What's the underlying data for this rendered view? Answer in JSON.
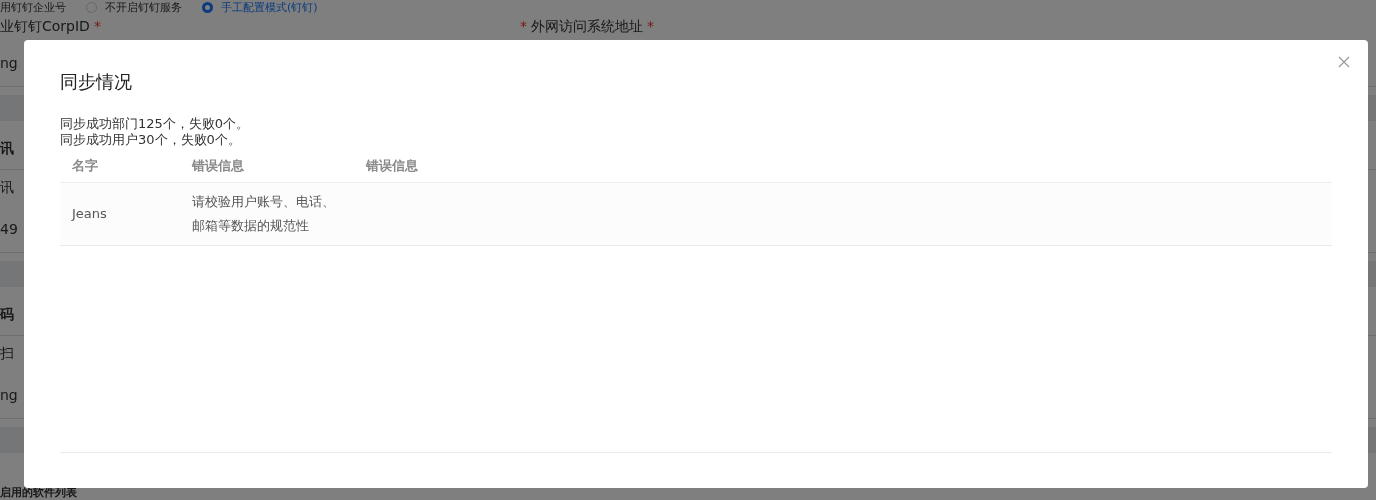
{
  "background": {
    "rows": [
      {
        "kind": "radios",
        "label": "用钉钉企业号",
        "options": [
          {
            "label": "不开启钉钉服务",
            "selected": false
          },
          {
            "label": "手工配置模式(钉钉)",
            "selected": true
          }
        ]
      },
      {
        "kind": "labels",
        "fields": [
          {
            "label": "业钉钉CorpID",
            "suffix": "*"
          },
          {
            "prefix": "*",
            "label": "外网访问系统地址",
            "suffix": "*"
          }
        ]
      },
      {
        "kind": "input",
        "value": "ng"
      },
      {
        "kind": "band"
      },
      {
        "kind": "section",
        "text": "讯"
      },
      {
        "kind": "text",
        "text": "讯"
      },
      {
        "kind": "input",
        "value": "49"
      },
      {
        "kind": "band"
      },
      {
        "kind": "section",
        "text": "码"
      },
      {
        "kind": "text",
        "text": "扫"
      },
      {
        "kind": "input",
        "value": "ng"
      },
      {
        "kind": "band"
      },
      {
        "kind": "section",
        "text": "启用的软件列表"
      }
    ]
  },
  "dialog": {
    "title": "同步情况",
    "summary": [
      "同步成功部门125个，失败0个。",
      "同步成功用户30个，失败0个。"
    ],
    "table": {
      "columns": [
        "名字",
        "错误信息",
        "错误信息"
      ],
      "rows": [
        [
          "Jeans",
          "请校验用户账号、电话、邮箱等数据的规范性",
          ""
        ]
      ]
    }
  }
}
